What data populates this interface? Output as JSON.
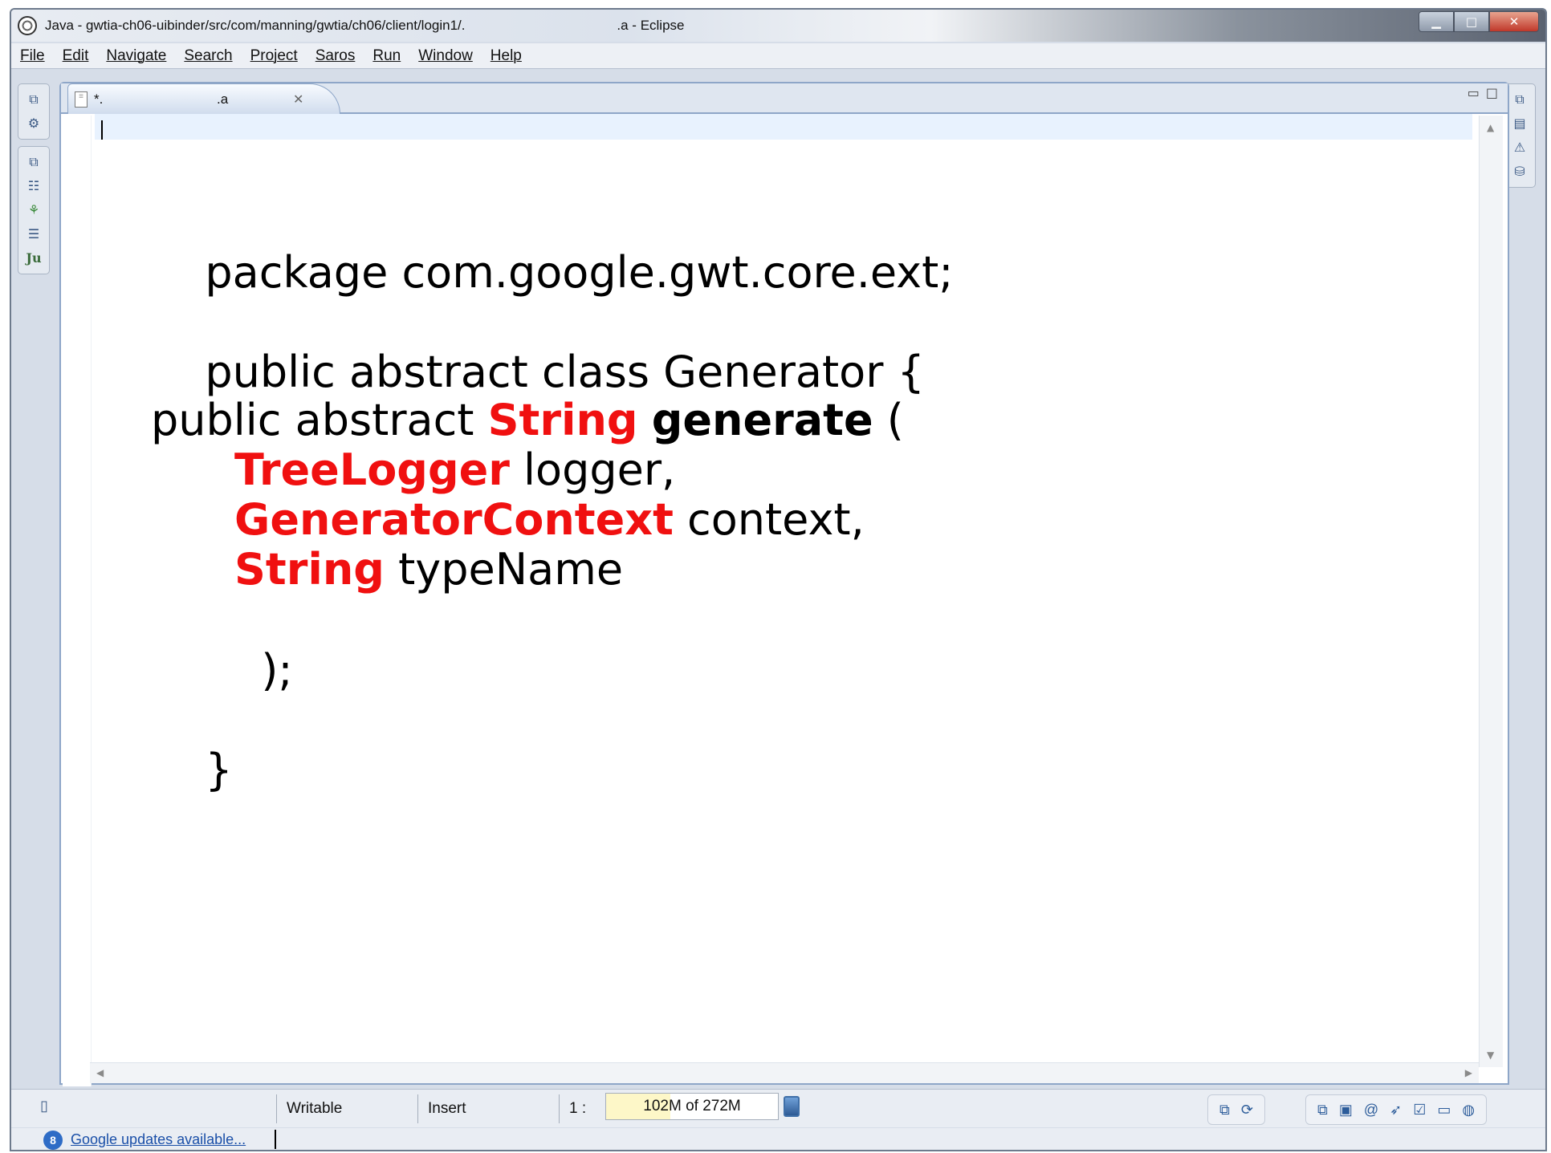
{
  "window": {
    "title": "Java - gwtia-ch06-uibinder/src/com/manning/gwtia/ch06/client/login1/.                                        .a - Eclipse",
    "controls": {
      "minimize": "▁",
      "maximize": "□",
      "close": "✕"
    }
  },
  "menu": [
    "File",
    "Edit",
    "Navigate",
    "Search",
    "Project",
    "Saros",
    "Run",
    "Window",
    "Help"
  ],
  "editor": {
    "tab_label": "*.                              .a",
    "tab_close": "✕",
    "code": {
      "line1": "package com.google.gwt.core.ext;",
      "line2": "public abstract class Generator {",
      "line3_pre": "public abstract ",
      "line3_type": "String",
      "line3_space": " ",
      "line3_method": "generate",
      "line3_post": " (",
      "line4_type": "TreeLogger",
      "line4_rest": " logger,",
      "line5_type": "GeneratorContext",
      "line5_rest": " context,",
      "line6_type": "String",
      "line6_rest": " typeName",
      "line7": ");",
      "line8": "}"
    }
  },
  "status": {
    "writable": "Writable",
    "insert_mode": "Insert",
    "position": "1 :",
    "heap": "102M of 272M",
    "heap_fraction": 0.375
  },
  "notification": {
    "text": "Google updates available...",
    "icon": "8"
  },
  "icons": {
    "left_trim": [
      "restore-icon",
      "tasks-icon",
      "restore-icon",
      "hierarchy-icon",
      "tree-icon",
      "outline-icon",
      "junit-icon"
    ],
    "right_trim": [
      "restore-icon",
      "console-icon",
      "problems-icon",
      "servers-icon"
    ]
  }
}
